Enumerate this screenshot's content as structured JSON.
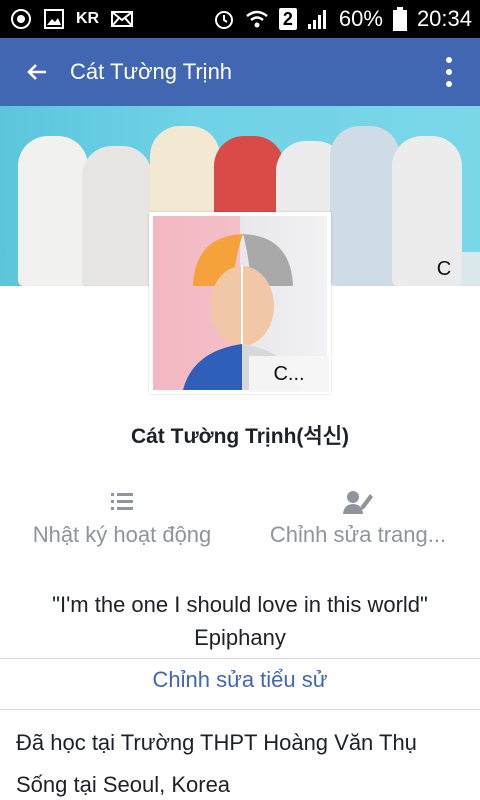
{
  "status_bar": {
    "carrier": "KR",
    "network_badge": "2",
    "battery_percent": "60%",
    "time": "20:34",
    "icons": [
      "record-icon",
      "image-icon",
      "mail-icon",
      "alarm-icon",
      "wifi-icon",
      "signal-icon",
      "battery-icon"
    ]
  },
  "app_bar": {
    "title": "Cát Tường Trịnh",
    "back_icon": "arrow-left-icon",
    "menu_icon": "more-vertical-icon"
  },
  "cover": {
    "edit_label": "C"
  },
  "avatar": {
    "edit_label": "C..."
  },
  "profile": {
    "name": "Cát Tường Trịnh(석신)"
  },
  "actions": [
    {
      "icon": "list-icon",
      "label": "Nhật ký hoạt động"
    },
    {
      "icon": "edit-profile-icon",
      "label": "Chỉnh sửa trang..."
    }
  ],
  "bio": {
    "line1": "\"I'm the one I should love in this world\"",
    "line2": "Epiphany",
    "edit_label": "Chỉnh sửa tiểu sử"
  },
  "info": {
    "education": "Đã học tại Trường THPT Hoàng Văn Thụ",
    "location": "Sống tại Seoul, Korea"
  },
  "colors": {
    "brand": "#4267b2",
    "muted": "#90949c",
    "text": "#1d2129"
  }
}
